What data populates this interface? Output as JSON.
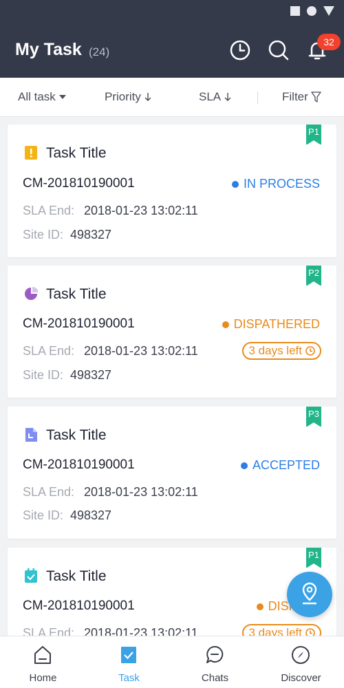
{
  "header": {
    "title": "My Task",
    "count": "(24)",
    "notification_count": "32"
  },
  "filters": {
    "all_task": "All task",
    "priority": "Priority",
    "sla": "SLA",
    "filter": "Filter"
  },
  "labels": {
    "sla_end": "SLA End:",
    "site_id": "Site ID:"
  },
  "tasks": [
    {
      "priority": "P1",
      "title": "Task Title",
      "id": "CM-201810190001",
      "status": "IN PROCESS",
      "status_color": "#2c7ee6",
      "sla_end": "2018-01-23 13:02:11",
      "site_id": "498327",
      "icon": "warning-note-icon"
    },
    {
      "priority": "P2",
      "title": "Task Title",
      "id": "CM-201810190001",
      "status": "DISPATHERED",
      "status_color": "#ea8a1b",
      "sla_end": "2018-01-23 13:02:11",
      "site_id": "498327",
      "time_left": "3 days left",
      "icon": "pie-chart-icon"
    },
    {
      "priority": "P3",
      "title": "Task Title",
      "id": "CM-201810190001",
      "status": "ACCEPTED",
      "status_color": "#2c7ee6",
      "sla_end": "2018-01-23 13:02:11",
      "site_id": "498327",
      "icon": "document-icon"
    },
    {
      "priority": "P1",
      "title": "Task Title",
      "id": "CM-201810190001",
      "status": "DISPATH",
      "status_color": "#ea8a1b",
      "sla_end": "2018-01-23 13:02:11",
      "time_left": "3 days left",
      "icon": "calendar-check-icon"
    }
  ],
  "nav": [
    {
      "label": "Home",
      "icon": "home-icon"
    },
    {
      "label": "Task",
      "icon": "task-check-icon",
      "active": true
    },
    {
      "label": "Chats",
      "icon": "chat-bubble-icon"
    },
    {
      "label": "Discover",
      "icon": "compass-icon"
    }
  ],
  "colors": {
    "header_bg": "#353a4b",
    "accent": "#3ba2e6",
    "priority_tag": "#23b58a",
    "warning": "#ea8a1b",
    "info": "#2c7ee6"
  }
}
